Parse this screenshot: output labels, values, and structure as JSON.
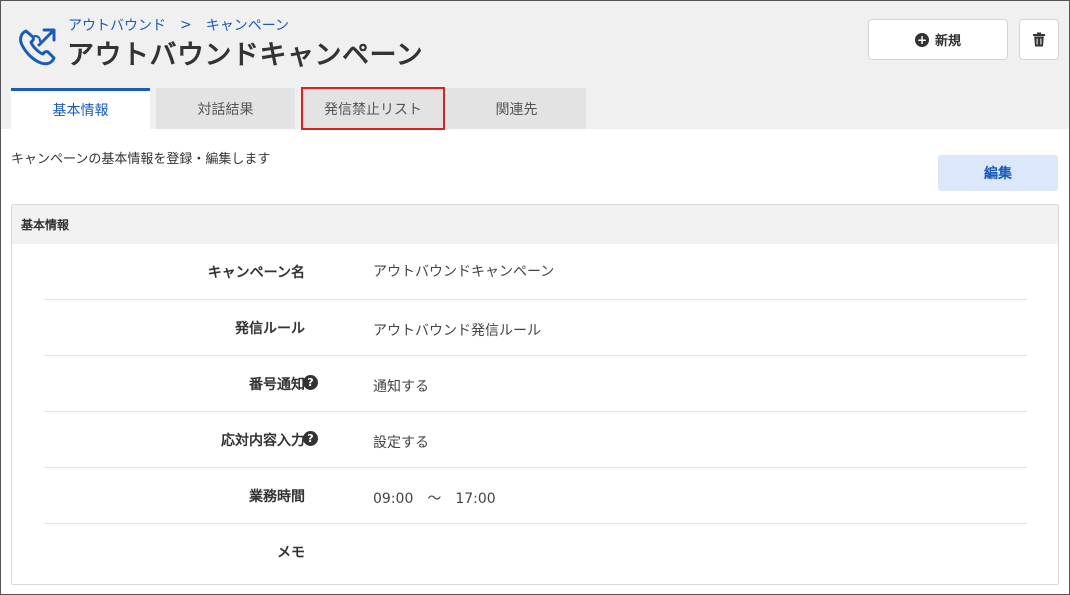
{
  "breadcrumb": {
    "parent": "アウトバウンド",
    "separator": ">",
    "current": "キャンペーン"
  },
  "page": {
    "title": "アウトバウンドキャンペーン"
  },
  "actions": {
    "new_label": "新規",
    "delete_icon": "trash-icon"
  },
  "tabs": [
    {
      "label": "基本情報",
      "active": true
    },
    {
      "label": "対話結果",
      "active": false
    },
    {
      "label": "発信禁止リスト",
      "active": false,
      "highlighted": true
    },
    {
      "label": "関連先",
      "active": false
    }
  ],
  "description": "キャンペーンの基本情報を登録・編集します",
  "edit_label": "編集",
  "panel": {
    "title": "基本情報",
    "rows": [
      {
        "label": "キャンペーン名",
        "value": "アウトバウンドキャンペーン",
        "help": false
      },
      {
        "label": "発信ルール",
        "value": "アウトバウンド発信ルール",
        "help": false
      },
      {
        "label": "番号通知",
        "value": "通知する",
        "help": true
      },
      {
        "label": "応対内容入力",
        "value": "設定する",
        "help": true
      },
      {
        "label": "業務時間",
        "value": "09:00　～　17:00",
        "help": false
      },
      {
        "label": "メモ",
        "value": "",
        "help": false
      }
    ]
  },
  "colors": {
    "accent": "#1a5bb8",
    "highlight": "#e02020",
    "edit_button_bg": "#dde7fb"
  }
}
